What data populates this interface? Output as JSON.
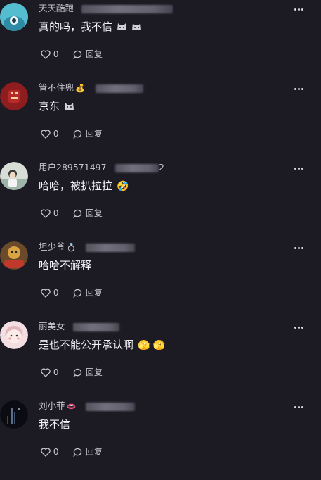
{
  "actions": {
    "like_count": "0",
    "reply_label": "回复"
  },
  "comments": [
    {
      "user": "天天酷跑",
      "text": "真的吗，我不信",
      "emoji": [
        "cat-face-emoji",
        "cat-face-emoji"
      ]
    },
    {
      "user": "管不住兜",
      "user_badge": "💰",
      "text": "京东",
      "emoji": [
        "cat-face-emoji"
      ]
    },
    {
      "user": "用户289571497",
      "user_suffix": "2",
      "text": "哈哈，被扒拉拉",
      "emoji_text": "🤣"
    },
    {
      "user": "坦少爷",
      "user_badge": "💍",
      "text": "哈哈不解释"
    },
    {
      "user": "丽美女",
      "text": "是也不能公开承认啊",
      "emoji_text": "🫣  🫣"
    },
    {
      "user": "刘小菲",
      "user_badge": "👄",
      "text": "我不信"
    }
  ],
  "colors": {
    "background": "#1c1b24",
    "text": "#f2f1f6",
    "secondary_text": "#c6c5cf"
  }
}
